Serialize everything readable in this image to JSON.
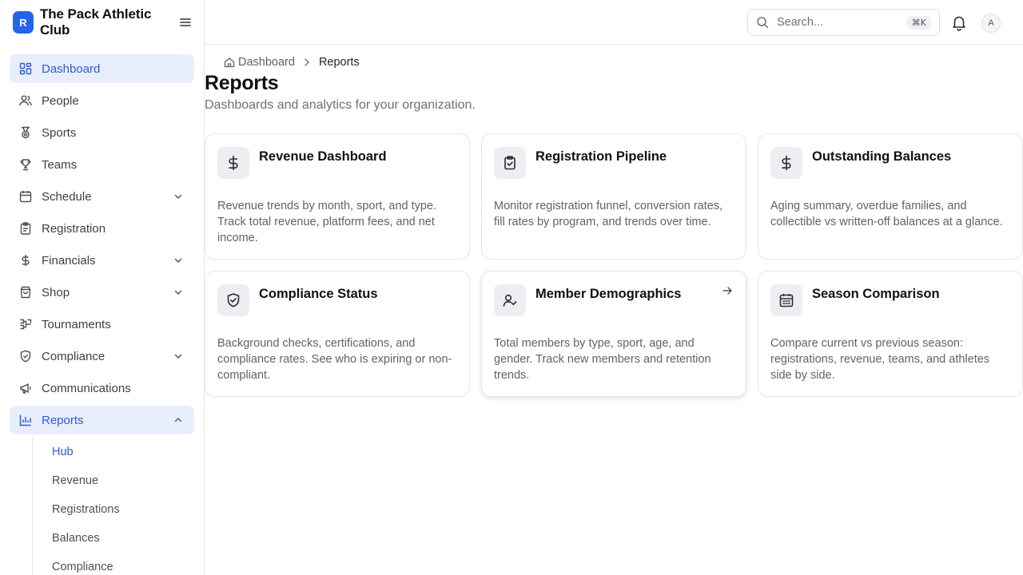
{
  "brand": {
    "logo_letter": "R",
    "name": "The Pack Athletic Club",
    "accent": "#2563eb"
  },
  "sidebar": {
    "items": [
      {
        "label": "Dashboard",
        "icon": "dashboard-icon"
      },
      {
        "label": "People",
        "icon": "users-icon"
      },
      {
        "label": "Sports",
        "icon": "medal-icon"
      },
      {
        "label": "Teams",
        "icon": "trophy-icon"
      },
      {
        "label": "Schedule",
        "icon": "calendar-icon"
      },
      {
        "label": "Registration",
        "icon": "clipboard-icon"
      },
      {
        "label": "Financials",
        "icon": "dollar-icon"
      },
      {
        "label": "Shop",
        "icon": "shopping-bag-icon"
      },
      {
        "label": "Tournaments",
        "icon": "bracket-icon"
      },
      {
        "label": "Compliance",
        "icon": "shield-icon"
      },
      {
        "label": "Communications",
        "icon": "megaphone-icon"
      },
      {
        "label": "Reports",
        "icon": "bar-chart-icon"
      }
    ],
    "reports_sub": [
      "Hub",
      "Revenue",
      "Registrations",
      "Balances",
      "Compliance"
    ]
  },
  "topbar": {
    "search_placeholder": "Search...",
    "shortcut": "⌘K",
    "avatar_initial": "A"
  },
  "breadcrumb": {
    "home": "Dashboard",
    "current": "Reports"
  },
  "page": {
    "title": "Reports",
    "subtitle": "Dashboards and analytics for your organization."
  },
  "cards": [
    {
      "title": "Revenue Dashboard",
      "icon": "dollar-icon",
      "description": "Revenue trends by month, sport, and type. Track total revenue, platform fees, and net income."
    },
    {
      "title": "Registration Pipeline",
      "icon": "clipboard-check-icon",
      "description": "Monitor registration funnel, conversion rates, fill rates by program, and trends over time."
    },
    {
      "title": "Outstanding Balances",
      "icon": "dollar-icon",
      "description": "Aging summary, overdue families, and collectible vs written-off balances at a glance."
    },
    {
      "title": "Compliance Status",
      "icon": "shield-check-icon",
      "description": "Background checks, certifications, and compliance rates. See who is expiring or non-compliant."
    },
    {
      "title": "Member Demographics",
      "icon": "user-check-icon",
      "description": "Total members by type, sport, age, and gender. Track new members and retention trends."
    },
    {
      "title": "Season Comparison",
      "icon": "calendar-grid-icon",
      "description": "Compare current vs previous season: registrations, revenue, teams, and athletes side by side."
    }
  ]
}
